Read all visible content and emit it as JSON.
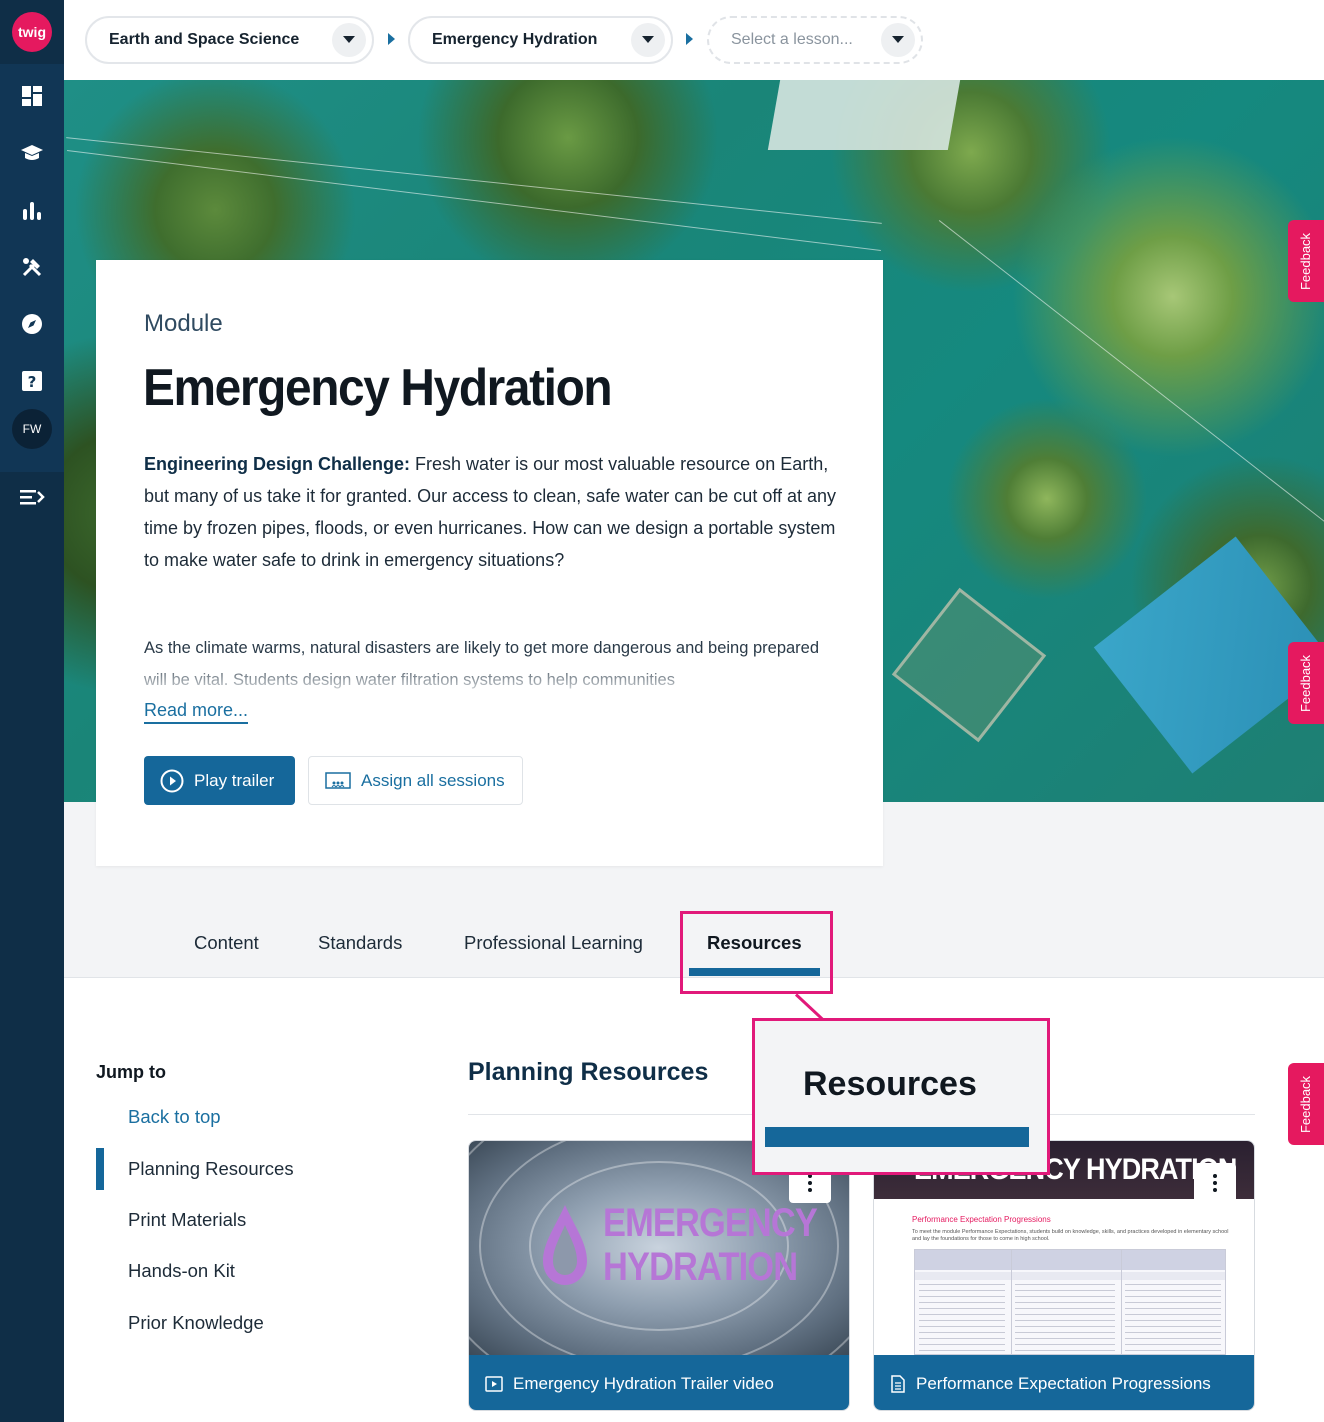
{
  "sidebar": {
    "logo": "twig",
    "avatar": "FW",
    "icons": [
      "dashboard-icon",
      "graduation-cap-icon",
      "bar-chart-icon",
      "tools-icon",
      "compass-icon",
      "help-icon",
      "collapse-menu-icon"
    ]
  },
  "breadcrumb": {
    "subject": "Earth and Space Science",
    "module": "Emergency Hydration",
    "lesson_placeholder": "Select a lesson..."
  },
  "feedback_label": "Feedback",
  "module": {
    "eyebrow": "Module",
    "title": "Emergency Hydration",
    "challenge_label": "Engineering Design Challenge:",
    "challenge_text": " Fresh water is our most valuable resource on Earth, but many of us take it for granted. Our access to clean, safe water can be cut off at any time by frozen pipes, floods, or even hurricanes. How can we design a portable system to make water safe to drink in emergency situations?",
    "paragraph": "As the climate warms, natural disasters are likely to get more dangerous and being prepared will be vital. Students design water filtration systems to help communities",
    "read_more": "Read more...",
    "play_trailer": "Play trailer",
    "assign_all": "Assign all sessions"
  },
  "tabs": [
    "Content",
    "Standards",
    "Professional Learning",
    "Resources"
  ],
  "active_tab": "Resources",
  "callout_label": "Resources",
  "jump_to": {
    "heading": "Jump to",
    "items": [
      "Back to top",
      "Planning Resources",
      "Print Materials",
      "Hands-on Kit",
      "Prior Knowledge"
    ],
    "active": "Planning Resources"
  },
  "planning": {
    "title": "Planning Resources",
    "cards": [
      {
        "label": "Emergency Hydration Trailer video",
        "thumb_title_1": "EMERGENCY",
        "thumb_title_2": "HYDRATION",
        "icon": "video-icon"
      },
      {
        "label": "Performance Expectation Progressions",
        "thumb_header": "EMERGENCY HYDRATION",
        "doc_title": "Performance Expectation Progressions",
        "doc_sub": "To meet the module Performance Expectations, students build on knowledge, skills, and practices developed in elementary school and lay the foundations for those to come in high school.",
        "icon": "document-icon"
      }
    ]
  },
  "colors": {
    "sidebar": "#0f2e47",
    "accent": "#15679a",
    "brand": "#e5195f",
    "highlight": "#e1197a"
  }
}
